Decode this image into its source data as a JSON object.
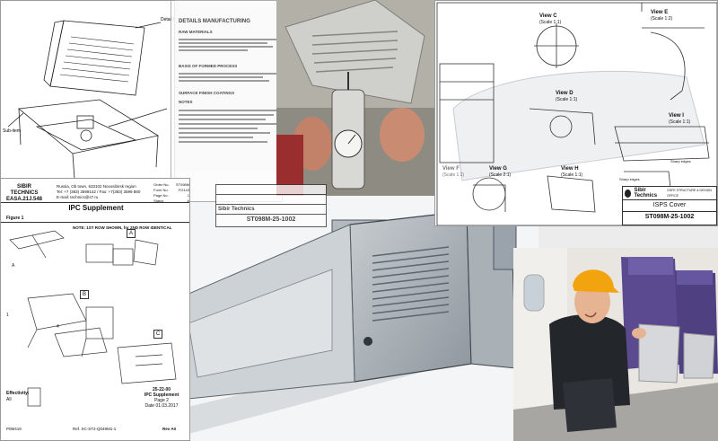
{
  "ipc_sheet": {
    "logo_line1": "SIBIR",
    "logo_line2": "TECHNICS",
    "logo_line3": "EASA.21J.548",
    "address_line1": "Russia, Ob town, 633102 Novosibirsk region",
    "address_line2": "Tel: +7 (383) 3599142 / Fax: +7(383) 3599 880",
    "address_line3": "E-mail: technics@s7.ru",
    "order_label": "Order No.",
    "order_value": "ST098M",
    "form_label": "Form No.",
    "form_value": "FO143",
    "page_label": "Page No.",
    "page_value": "1",
    "status_label": "Status",
    "status_value": "A",
    "title": "IPC Supplement",
    "figure": "Figure 1",
    "note": "NOTE: 1ST ROW SHOWN, for 2ND ROW IDENTICAL",
    "view_a": "A",
    "view_b": "B",
    "view_c": "C",
    "effectivity_label": "Effectivity:",
    "effectivity_value": "All",
    "ata": "25-22-00",
    "footer_title": "IPC Supplement",
    "footer_page": "Page 2",
    "footer_date": "Date 01.03.2017",
    "footer_rev": "Rev A0",
    "footer_ref": "Ref. SC-ST2-Q049M1-1",
    "footer_code": "P0M419"
  },
  "details_sheet": {
    "title": "DETAILS MANUFACTURING",
    "section_1": "RAW MATERIALS",
    "section_2": "BASIS OF FORMED PROCESS",
    "section_3": "SURFACE FINISH COATINGS",
    "notes_heading": "NOTES",
    "frame_label": "Sibir Technics",
    "drawing_no": "ST098M-25-1002"
  },
  "cover_sheet": {
    "title": "ISPS Cover",
    "company": "Sibir Technics",
    "company_sub": "GSFE STRUCTURE & DESIGN OFFICE",
    "drawing_no": "ST098M-25-1002",
    "view_c": "View C",
    "view_c_scale": "(Scale 1:1)",
    "view_e": "View E",
    "view_e_scale": "(Scale 1:2)",
    "view_d": "View D",
    "view_d_scale": "(Scale 1:1)",
    "view_i": "View I",
    "view_i_scale": "(Scale 1:1)",
    "view_h": "View H",
    "view_h_scale": "(Scale 1:1)",
    "view_g": "View G",
    "view_g_scale": "(Scale 2:1)",
    "view_f": "View F",
    "view_f_scale": "(Scale 1:2)",
    "sharp_edges": "Sharp edges",
    "sharp_edges_2": "Sharp edges"
  },
  "colors": {
    "seat_purple": "#5b4a8f",
    "cap_orange": "#f2a40f",
    "cad_grey": "#9aa3ab"
  }
}
